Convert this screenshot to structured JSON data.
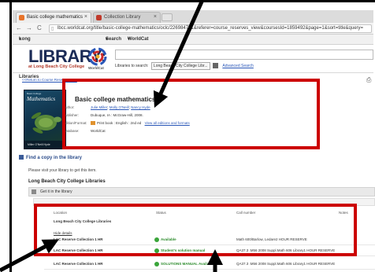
{
  "browser": {
    "tabs": [
      {
        "label": "Basic college mathematics",
        "active": true,
        "close": "×"
      },
      {
        "label": "Collection Library",
        "active": false,
        "close": "×"
      }
    ],
    "nav": {
      "back": "←",
      "forward": "→",
      "reload": "C"
    },
    "url": "lbcc.worldcat.org/title/basic-college-mathematics/oclc/226984771&referer=course_reserves_view&coursesId=1859492&page=1&sort=title&query="
  },
  "navbar": {
    "library": "Long Beach City College Libraries",
    "search": "Search",
    "worldcat": "WorldCat",
    "caret": "▾"
  },
  "header": {
    "logo_text": "LIBRARY:",
    "logo_sub": "at Long Beach City College",
    "worldcat_mark": "WorldCat",
    "search_value": "",
    "libraries_label": "Libraries to search:",
    "libraries_select": "Long Beach City College Libr...",
    "advanced_search": "Advanced Search"
  },
  "content": {
    "return_link": "<<Return to Course Reserves Ite...",
    "printer_icon": "⎙",
    "cover": {
      "title": "Mathematics",
      "sub": "Basic College",
      "authors": "Miller  O'Neill  Hyde"
    },
    "title": "Basic college mathematics",
    "meta": {
      "author_label": "Author:",
      "authors": [
        "Julie Miller",
        "Molly O'Neill",
        "Nancy Hyde"
      ],
      "publisher_label": "Publisher:",
      "publisher": "Dubuque, IA : McGraw-Hill, 2008.",
      "edition_label": "Edition/Format:",
      "edition": "Print book : English : 2nd ed",
      "edition_link": "View all editions and formats",
      "database_label": "Database:",
      "database": "WorldCat"
    },
    "find_copy": "Find a copy in the library",
    "find_msg": "Please visit your library to get this item.",
    "library_name": "Long Beach City College Libraries",
    "get_it": "Get it in the library"
  },
  "holdings": {
    "headers": {
      "location": "Location",
      "status": "Status",
      "call_number": "Call number",
      "notes": "Notes"
    },
    "group_name": "Long Beach City College Libraries",
    "details_link": "Hide details",
    "rows": [
      {
        "location": "LAC Reserve Collection 1 HR",
        "status": "Available",
        "call_number": "Math 600/Barlow, Ledare2 HOUR RESERVE"
      },
      {
        "location": "LAC Reserve Collection 1 HR",
        "status": "Student's solution manual",
        "call_number": "QA37.3 .M56 2008 Suppl.Math 606 Library1 HOUR RESERVE"
      },
      {
        "location": "LAC Reserve Collection 1 HR",
        "status": "SOLUTIONS MANUAL Available",
        "call_number": "QA37.3 .M56 2008 Suppl.Math 606 Library1 HOUR RESERVE"
      }
    ]
  },
  "colors": {
    "annotation_red": "#cc0000",
    "link_blue": "#2a57b8",
    "logo_navy": "#1a2a55"
  }
}
